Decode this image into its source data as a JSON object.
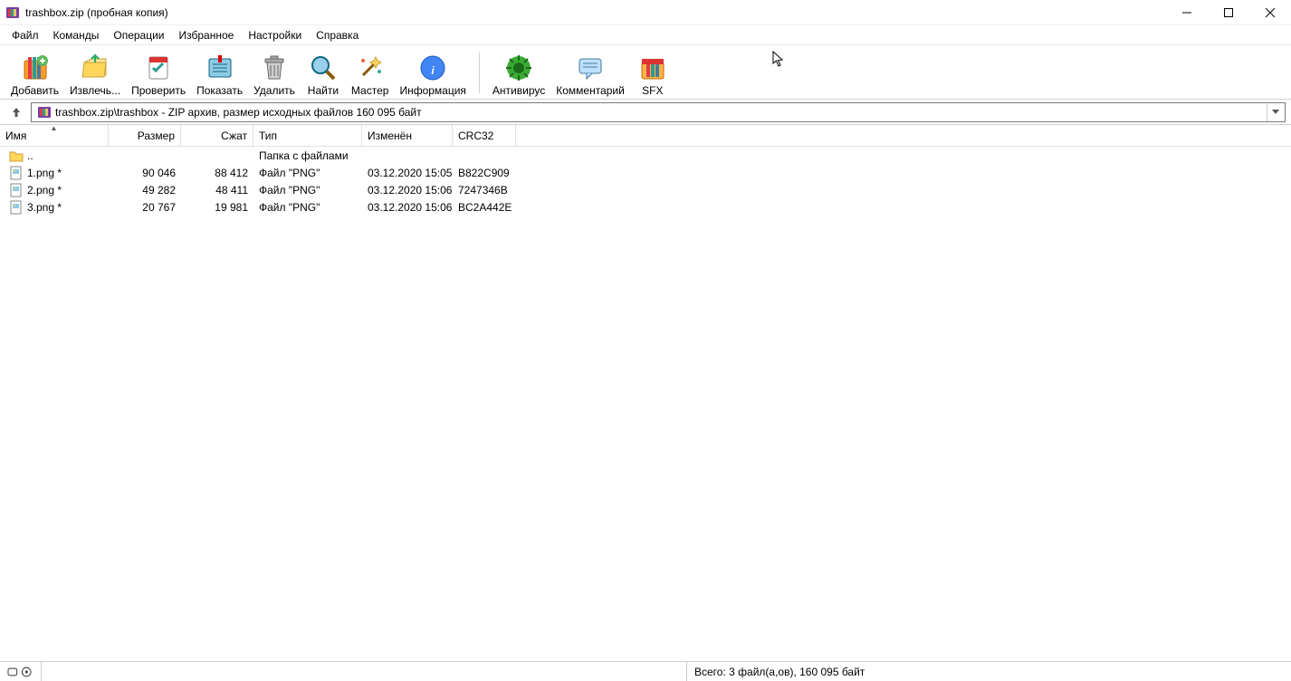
{
  "title": "trashbox.zip (пробная копия)",
  "menu": [
    "Файл",
    "Команды",
    "Операции",
    "Избранное",
    "Настройки",
    "Справка"
  ],
  "toolbar": [
    {
      "id": "add",
      "label": "Добавить"
    },
    {
      "id": "extract",
      "label": "Извлечь..."
    },
    {
      "id": "test",
      "label": "Проверить"
    },
    {
      "id": "view",
      "label": "Показать"
    },
    {
      "id": "delete",
      "label": "Удалить"
    },
    {
      "id": "find",
      "label": "Найти"
    },
    {
      "id": "wizard",
      "label": "Мастер"
    },
    {
      "id": "info",
      "label": "Информация"
    },
    {
      "id": "sep"
    },
    {
      "id": "antivirus",
      "label": "Антивирус"
    },
    {
      "id": "comment",
      "label": "Комментарий"
    },
    {
      "id": "sfx",
      "label": "SFX"
    }
  ],
  "path": "trashbox.zip\\trashbox - ZIP архив, размер исходных файлов 160 095 байт",
  "columns": {
    "name": "Имя",
    "size": "Размер",
    "packed": "Сжат",
    "type": "Тип",
    "date": "Изменён",
    "crc": "CRC32"
  },
  "rows": [
    {
      "name": "..",
      "size": "",
      "packed": "",
      "type": "Папка с файлами",
      "date": "",
      "crc": "",
      "kind": "folder"
    },
    {
      "name": "1.png *",
      "size": "90 046",
      "packed": "88 412",
      "type": "Файл \"PNG\"",
      "date": "03.12.2020 15:05",
      "crc": "B822C909",
      "kind": "file"
    },
    {
      "name": "2.png *",
      "size": "49 282",
      "packed": "48 411",
      "type": "Файл \"PNG\"",
      "date": "03.12.2020 15:06",
      "crc": "7247346B",
      "kind": "file"
    },
    {
      "name": "3.png *",
      "size": "20 767",
      "packed": "19 981",
      "type": "Файл \"PNG\"",
      "date": "03.12.2020 15:06",
      "crc": "BC2A442E",
      "kind": "file"
    }
  ],
  "status": {
    "segA": "",
    "total": "Всего: 3 файл(а,ов), 160 095 байт"
  }
}
